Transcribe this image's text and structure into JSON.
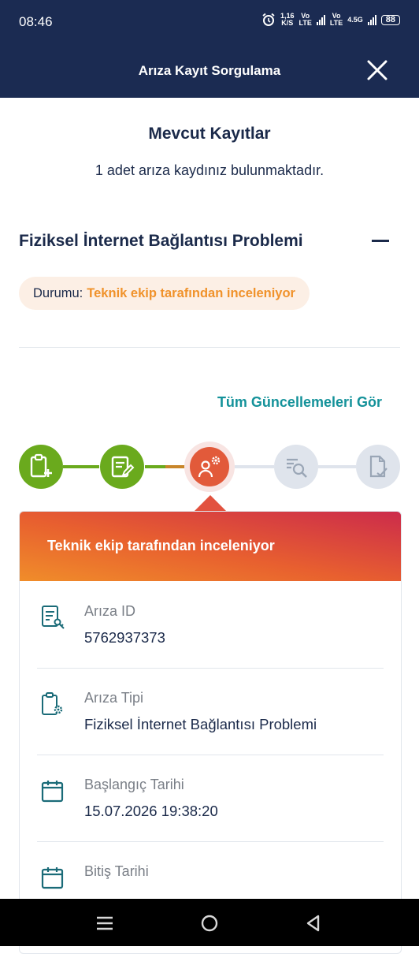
{
  "status_bar": {
    "time": "08:46",
    "speed_value": "1,16",
    "speed_unit": "K/S",
    "sim1_top": "Vo",
    "sim1_bottom": "LTE",
    "sim2_top": "Vo",
    "sim2_bottom": "LTE",
    "network": "4.5G",
    "battery": "88"
  },
  "app_bar": {
    "title": "Arıza Kayıt Sorgulama",
    "close_icon": "close-icon"
  },
  "main": {
    "heading": "Mevcut Kayıtlar",
    "subtitle": "1 adet arıza kaydınız bulunmaktadır.",
    "record": {
      "title": "Fiziksel İnternet Bağlantısı Problemi",
      "status_label": "Durumu:",
      "status_value": "Teknik ekip tarafından inceleniyor",
      "all_updates_link": "Tüm Güncellemeleri Gör"
    },
    "steps": [
      {
        "icon": "clipboard-add-icon",
        "state": "done"
      },
      {
        "icon": "document-edit-icon",
        "state": "done"
      },
      {
        "icon": "technician-gear-icon",
        "state": "active"
      },
      {
        "icon": "search-list-icon",
        "state": "pending"
      },
      {
        "icon": "document-check-icon",
        "state": "pending"
      }
    ],
    "colors": {
      "done": "#6aaa1d",
      "active": "#e25a3a",
      "pending": "#dfe4ec",
      "accent": "#14929a",
      "status_text": "#f0922b",
      "navy": "#1b2b52"
    },
    "detail_card": {
      "header": "Teknik ekip tarafından inceleniyor",
      "fields": [
        {
          "icon": "document-key-icon",
          "label": "Arıza ID",
          "value": "5762937373"
        },
        {
          "icon": "clipboard-gear-icon",
          "label": "Arıza Tipi",
          "value": "Fiziksel İnternet Bağlantısı Problemi"
        },
        {
          "icon": "calendar-icon",
          "label": "Başlangıç Tarihi",
          "value": "15.07.2026 19:38:20"
        },
        {
          "icon": "calendar-icon",
          "label": "Bitiş Tarihi",
          "value": ""
        }
      ]
    }
  },
  "nav_bar": {
    "buttons": [
      "menu-icon",
      "home-icon",
      "back-icon"
    ]
  }
}
